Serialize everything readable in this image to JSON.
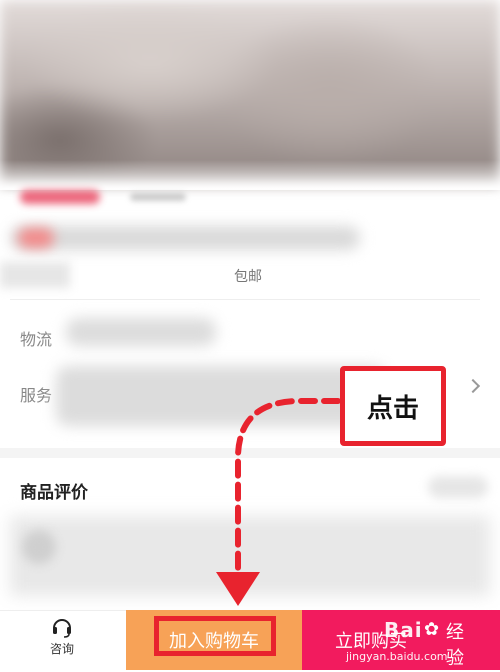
{
  "product": {
    "shipping_text": "包邮"
  },
  "rows": {
    "logistics_label": "物流",
    "service_label": "服务"
  },
  "reviews": {
    "title": "商品评价"
  },
  "annotation": {
    "label": "点击"
  },
  "bottom_bar": {
    "consult_label": "咨询",
    "add_to_cart_label": "加入购物车",
    "buy_now_label": "立即购买"
  },
  "watermark": {
    "logo": "Bai",
    "sub": "经验",
    "url": "jingyan.baidu.com"
  },
  "colors": {
    "accent_red": "#e8232e",
    "cart_orange": "#f7a257",
    "buy_pink": "#f21b5e"
  }
}
